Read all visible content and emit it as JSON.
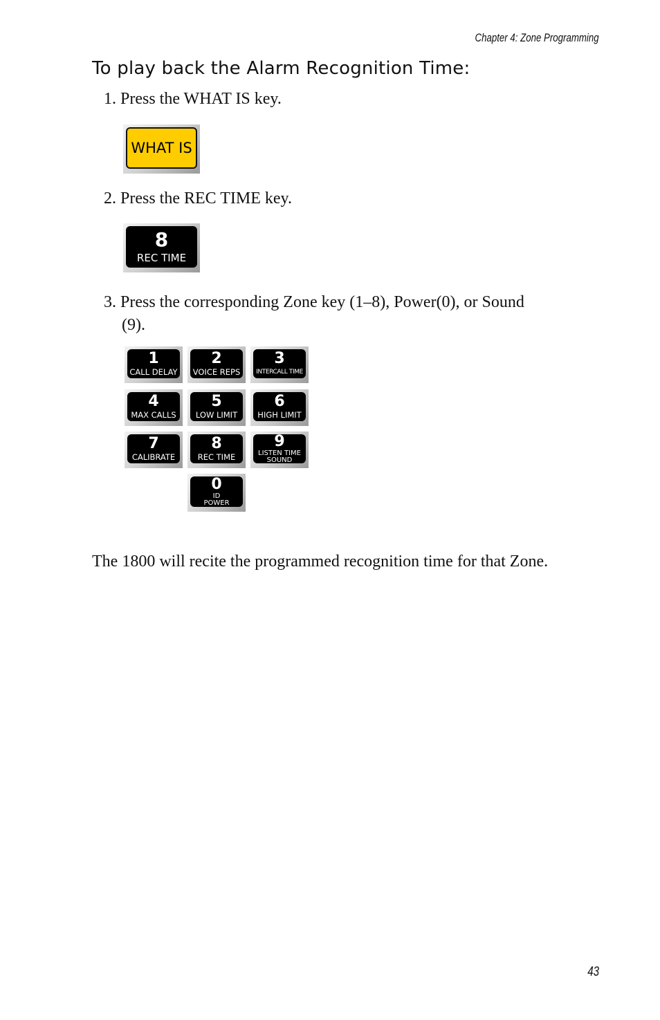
{
  "header": {
    "chapter": "Chapter 4: Zone Programming"
  },
  "page_number": "43",
  "section_title": "To play back the Alarm Recognition Time:",
  "steps": [
    {
      "text": "1. Press the WHAT IS key."
    },
    {
      "text": "2. Press the REC TIME key."
    },
    {
      "text": "3. Press the corresponding Zone key (1–8), Power(0), or Sound",
      "continuation": "(9)."
    }
  ],
  "keys": {
    "what_is": {
      "label": "WHAT IS",
      "color": "#ffcc00"
    },
    "rec_time": {
      "number": "8",
      "label": "REC TIME"
    },
    "keypad": [
      {
        "number": "1",
        "label": "CALL DELAY"
      },
      {
        "number": "2",
        "label": "VOICE REPS"
      },
      {
        "number": "3",
        "label": "INTERCALL TIME"
      },
      {
        "number": "4",
        "label": "MAX CALLS"
      },
      {
        "number": "5",
        "label": "LOW LIMIT"
      },
      {
        "number": "6",
        "label": "HIGH LIMIT"
      },
      {
        "number": "7",
        "label": "CALIBRATE"
      },
      {
        "number": "8",
        "label": "REC TIME"
      },
      {
        "number": "9",
        "label": "LISTEN TIME",
        "label2": "SOUND"
      },
      {
        "number": "0",
        "label": "ID",
        "label2": "POWER"
      }
    ]
  },
  "closing_paragraph": "The 1800 will recite the programmed recognition time for that Zone."
}
